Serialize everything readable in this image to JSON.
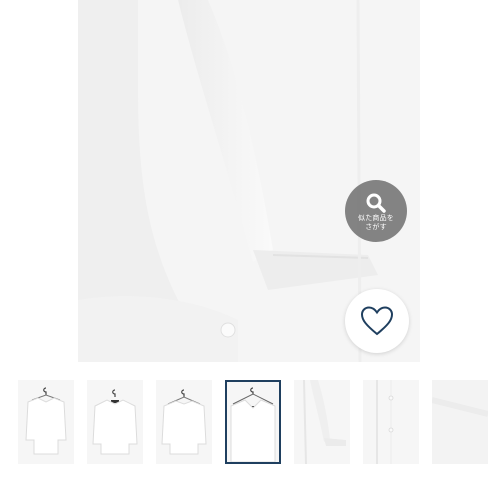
{
  "similar_search": {
    "icon": "magnifier-icon",
    "label_line1": "似た商品を",
    "label_line2": "さがす"
  },
  "favorite": {
    "icon": "heart-icon",
    "color": "#1f3f5f"
  },
  "thumbnails": {
    "selected_index": 3,
    "accent_color": "#1f3f5f",
    "items": [
      {
        "view": "hanger-front"
      },
      {
        "view": "flat-front"
      },
      {
        "view": "hanger-back"
      },
      {
        "view": "collar-detail"
      },
      {
        "view": "sleeve-detail"
      },
      {
        "view": "button-placket"
      },
      {
        "view": "fabric-texture"
      }
    ]
  }
}
